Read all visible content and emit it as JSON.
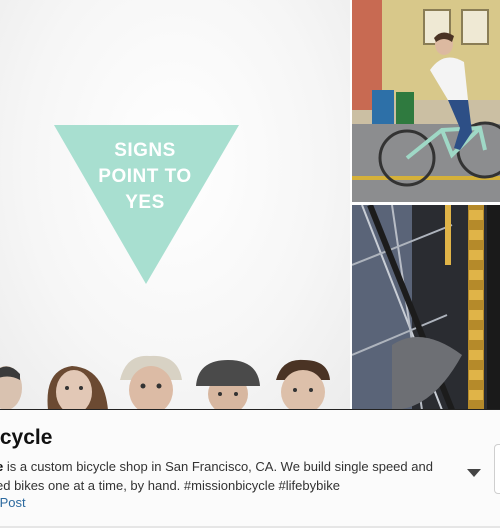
{
  "hero": {
    "sign_lines": [
      "SIGNS",
      "POINT TO",
      "YES"
    ],
    "triangle_color": "#a8dfd0"
  },
  "profile": {
    "title": "icycle",
    "bio_bold": "e",
    "bio_line1_rest": " is a custom bicycle shop in San Francisco, CA. We build single speed and",
    "bio_line2": "ed bikes one at a time, by hand. #missionbicycle #lifebybike",
    "link_text": "tPost"
  },
  "icons": {
    "expand": "chevron-down-icon"
  }
}
